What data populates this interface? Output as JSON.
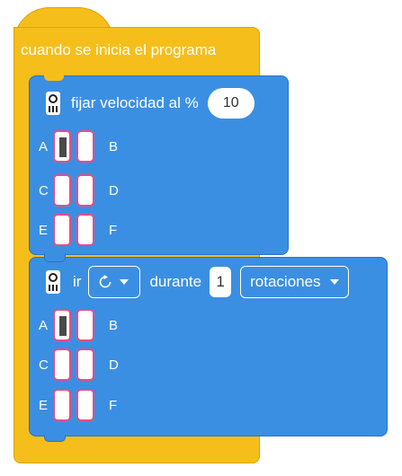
{
  "event_block": {
    "title": "cuando se inicia el programa"
  },
  "speed_block": {
    "label": "fijar velocidad al %",
    "value": "10",
    "ports": [
      {
        "left": "A",
        "right": "B"
      },
      {
        "left": "C",
        "right": "D"
      },
      {
        "left": "E",
        "right": "F"
      }
    ]
  },
  "run_block": {
    "verb": "ir",
    "direction_icon": "clockwise-icon",
    "duration_label": "durante",
    "amount": "1",
    "unit": "rotaciones",
    "ports": [
      {
        "left": "A",
        "right": "B"
      },
      {
        "left": "C",
        "right": "D"
      },
      {
        "left": "E",
        "right": "F"
      }
    ]
  },
  "colors": {
    "event": "#F5BE1A",
    "motor": "#3B8FE2",
    "port_border": "#EB4B85"
  }
}
